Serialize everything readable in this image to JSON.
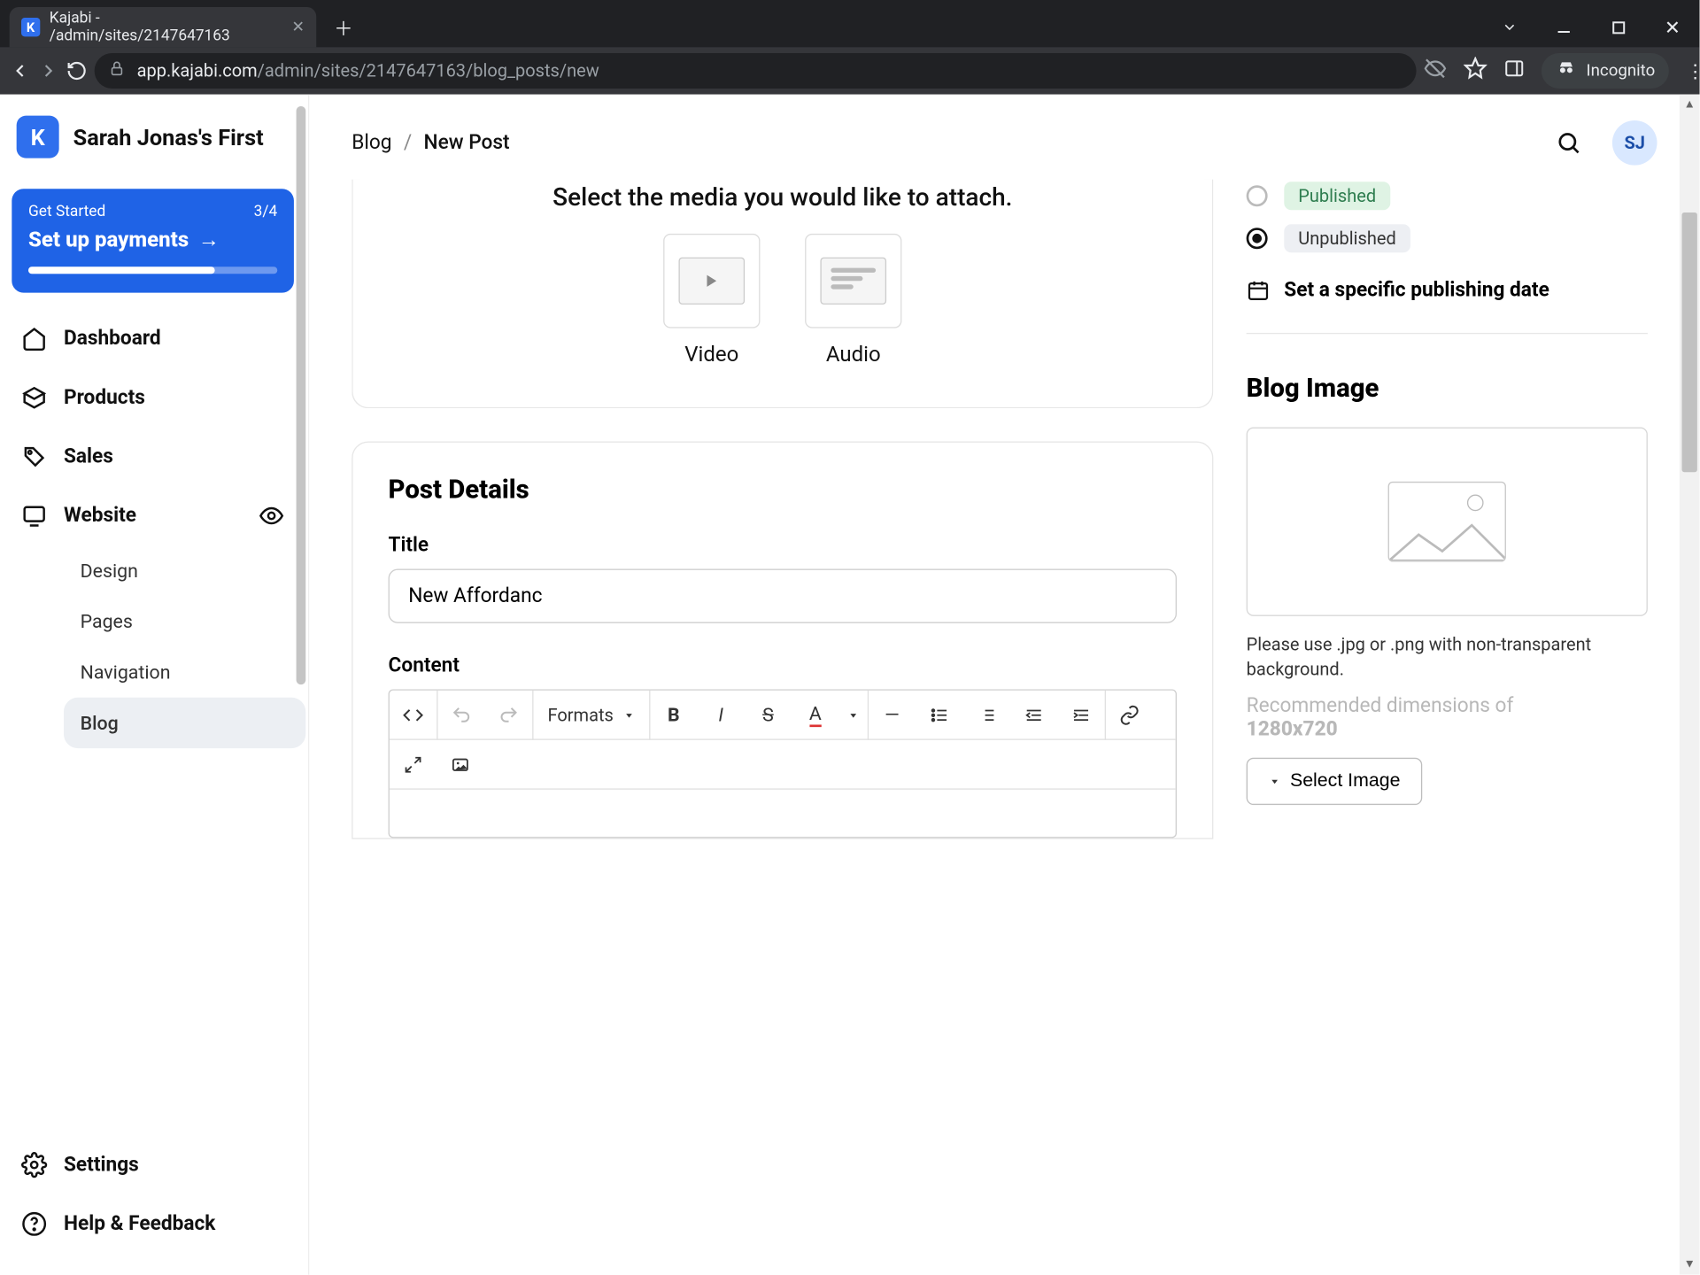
{
  "browser": {
    "tab_title": "Kajabi - /admin/sites/2147647163",
    "url_domain": "app.kajabi.com",
    "url_path": "/admin/sites/2147647163/blog_posts/new",
    "incognito_label": "Incognito"
  },
  "brand": {
    "site_name": "Sarah Jonas's First",
    "logo_letter": "K"
  },
  "get_started": {
    "label": "Get Started",
    "progress_text": "3/4",
    "cta": "Set up payments"
  },
  "sidebar": {
    "dashboard": "Dashboard",
    "products": "Products",
    "sales": "Sales",
    "website": "Website",
    "design": "Design",
    "pages": "Pages",
    "navigation": "Navigation",
    "blog": "Blog",
    "settings": "Settings",
    "help": "Help & Feedback"
  },
  "breadcrumb": {
    "root": "Blog",
    "current": "New Post"
  },
  "avatar_initials": "SJ",
  "media": {
    "prompt": "Select the media you would like to attach.",
    "video": "Video",
    "audio": "Audio"
  },
  "post": {
    "section": "Post Details",
    "title_label": "Title",
    "title_value": "New Affordanc",
    "content_label": "Content",
    "formats_label": "Formats"
  },
  "status": {
    "published": "Published",
    "unpublished": "Unpublished",
    "set_date": "Set a specific publishing date"
  },
  "blog_image": {
    "heading": "Blog Image",
    "hint": "Please use .jpg or .png with non-transparent background.",
    "rec1": "Recommended dimensions of",
    "rec2": "1280x720",
    "select": "Select Image"
  }
}
